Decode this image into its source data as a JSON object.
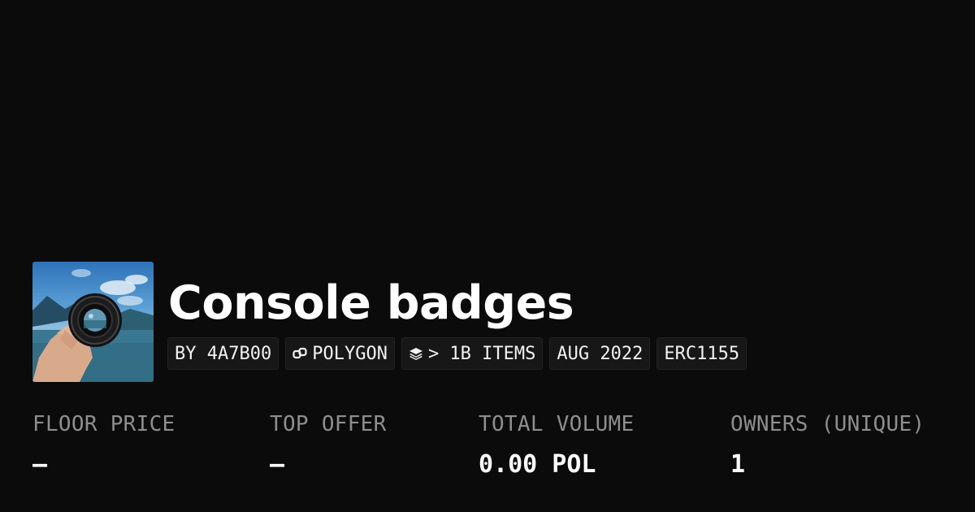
{
  "collection": {
    "title": "Console badges",
    "thumbnail_icon": "camera-lens-photo"
  },
  "chips": {
    "creator": "BY 4A7B00",
    "chain_icon": "polygon-link-icon",
    "chain": "POLYGON",
    "items_icon": "layers-icon",
    "items": "> 1B ITEMS",
    "date": "AUG 2022",
    "standard": "ERC1155"
  },
  "stats": {
    "floor_price": {
      "label": "FLOOR PRICE",
      "value": "–"
    },
    "top_offer": {
      "label": "TOP OFFER",
      "value": "–"
    },
    "total_volume": {
      "label": "TOTAL VOLUME",
      "value": "0.00 POL"
    },
    "owners": {
      "label": "OWNERS (UNIQUE)",
      "value": "1"
    }
  },
  "colors": {
    "background": "#0b0b0b",
    "chip_background": "#171717",
    "label_gray": "#8e8e8e",
    "text": "#ffffff"
  }
}
